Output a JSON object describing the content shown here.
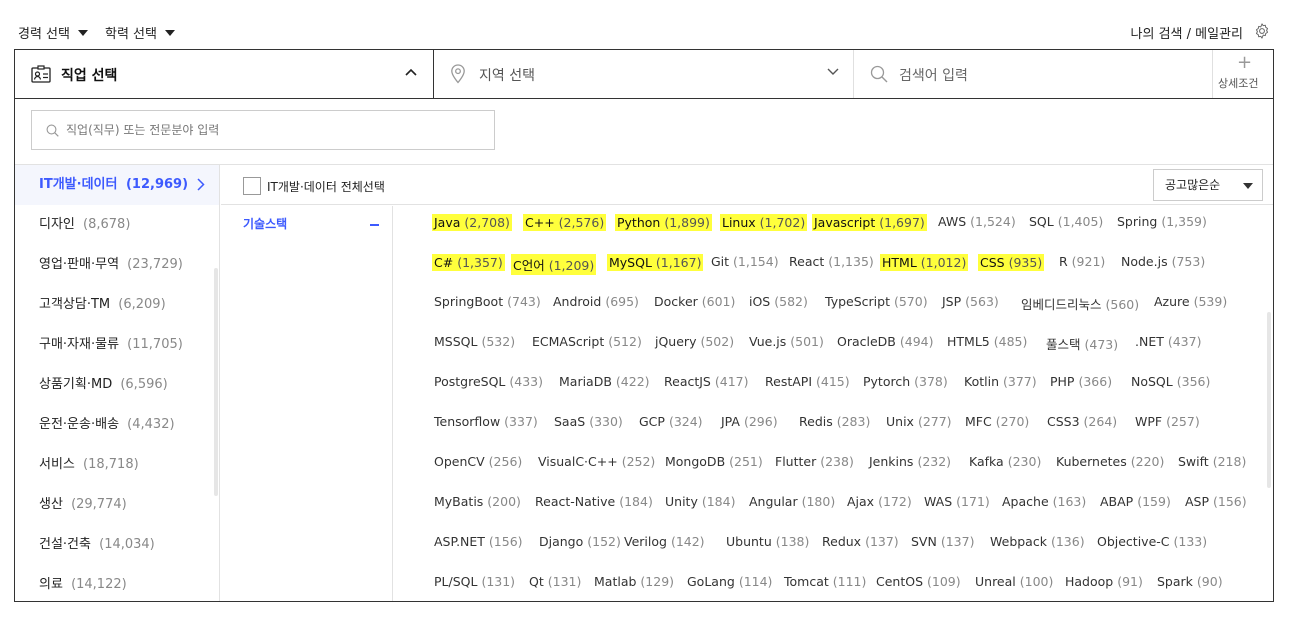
{
  "filters": {
    "career": "경력 선택",
    "education": "학력 선택",
    "my_search": "나의 검색 / 메일관리"
  },
  "searchbar": {
    "job": "직업 선택",
    "region": "지역 선택",
    "keyword_placeholder": "검색어 입력",
    "detail": "상세조건"
  },
  "job_search": {
    "placeholder": "직업(직무) 또는 전문분야 입력"
  },
  "categories": [
    {
      "name": "IT개발·데이터",
      "count": "(12,969)"
    },
    {
      "name": "디자인",
      "count": "(8,678)"
    },
    {
      "name": "영업·판매·무역",
      "count": "(23,729)"
    },
    {
      "name": "고객상담·TM",
      "count": "(6,209)"
    },
    {
      "name": "구매·자재·물류",
      "count": "(11,705)"
    },
    {
      "name": "상품기획·MD",
      "count": "(6,596)"
    },
    {
      "name": "운전·운송·배송",
      "count": "(4,432)"
    },
    {
      "name": "서비스",
      "count": "(18,718)"
    },
    {
      "name": "생산",
      "count": "(29,774)"
    },
    {
      "name": "건설·건축",
      "count": "(14,034)"
    },
    {
      "name": "의료",
      "count": "(14,122)"
    }
  ],
  "select_all_label": "IT개발·데이터 전체선택",
  "sort_label": "공고많은순",
  "subcategory": "기술스택",
  "skill_rows": [
    [
      {
        "name": "Java",
        "count": "(2,708)",
        "hl": true
      },
      {
        "name": "C++",
        "count": "(2,576)",
        "hl": true
      },
      {
        "name": "Python",
        "count": "(1,899)",
        "hl": true
      },
      {
        "name": "Linux",
        "count": "(1,702)",
        "hl": true
      },
      {
        "name": "Javascript",
        "count": "(1,697)",
        "hl": true
      },
      {
        "name": "AWS",
        "count": "(1,524)"
      },
      {
        "name": "SQL",
        "count": "(1,405)"
      },
      {
        "name": "Spring",
        "count": "(1,359)"
      }
    ],
    [
      {
        "name": "C#",
        "count": "(1,357)",
        "hl": true
      },
      {
        "name": "C언어",
        "count": "(1,209)",
        "hl": true
      },
      {
        "name": "MySQL",
        "count": "(1,167)",
        "hl": true
      },
      {
        "name": "Git",
        "count": "(1,154)"
      },
      {
        "name": "React",
        "count": "(1,135)"
      },
      {
        "name": "HTML",
        "count": "(1,012)",
        "hl": true
      },
      {
        "name": "CSS",
        "count": "(935)",
        "hl": true
      },
      {
        "name": "R",
        "count": "(921)"
      },
      {
        "name": "Node.js",
        "count": "(753)"
      }
    ],
    [
      {
        "name": "SpringBoot",
        "count": "(743)"
      },
      {
        "name": "Android",
        "count": "(695)"
      },
      {
        "name": "Docker",
        "count": "(601)"
      },
      {
        "name": "iOS",
        "count": "(582)"
      },
      {
        "name": "TypeScript",
        "count": "(570)"
      },
      {
        "name": "JSP",
        "count": "(563)"
      },
      {
        "name": "임베디드리눅스",
        "count": "(560)"
      },
      {
        "name": "Azure",
        "count": "(539)"
      }
    ],
    [
      {
        "name": "MSSQL",
        "count": "(532)"
      },
      {
        "name": "ECMAScript",
        "count": "(512)"
      },
      {
        "name": "jQuery",
        "count": "(502)"
      },
      {
        "name": "Vue.js",
        "count": "(501)"
      },
      {
        "name": "OracleDB",
        "count": "(494)"
      },
      {
        "name": "HTML5",
        "count": "(485)"
      },
      {
        "name": "풀스택",
        "count": "(473)"
      },
      {
        "name": ".NET",
        "count": "(437)"
      }
    ],
    [
      {
        "name": "PostgreSQL",
        "count": "(433)"
      },
      {
        "name": "MariaDB",
        "count": "(422)"
      },
      {
        "name": "ReactJS",
        "count": "(417)"
      },
      {
        "name": "RestAPI",
        "count": "(415)"
      },
      {
        "name": "Pytorch",
        "count": "(378)"
      },
      {
        "name": "Kotlin",
        "count": "(377)"
      },
      {
        "name": "PHP",
        "count": "(366)"
      },
      {
        "name": "NoSQL",
        "count": "(356)"
      }
    ],
    [
      {
        "name": "Tensorflow",
        "count": "(337)"
      },
      {
        "name": "SaaS",
        "count": "(330)"
      },
      {
        "name": "GCP",
        "count": "(324)"
      },
      {
        "name": "JPA",
        "count": "(296)"
      },
      {
        "name": "Redis",
        "count": "(283)"
      },
      {
        "name": "Unix",
        "count": "(277)"
      },
      {
        "name": "MFC",
        "count": "(270)"
      },
      {
        "name": "CSS3",
        "count": "(264)"
      },
      {
        "name": "WPF",
        "count": "(257)"
      }
    ],
    [
      {
        "name": "OpenCV",
        "count": "(256)"
      },
      {
        "name": "VisualC·C++",
        "count": "(252)"
      },
      {
        "name": "MongoDB",
        "count": "(251)"
      },
      {
        "name": "Flutter",
        "count": "(238)"
      },
      {
        "name": "Jenkins",
        "count": "(232)"
      },
      {
        "name": "Kafka",
        "count": "(230)"
      },
      {
        "name": "Kubernetes",
        "count": "(220)"
      },
      {
        "name": "Swift",
        "count": "(218)"
      }
    ],
    [
      {
        "name": "MyBatis",
        "count": "(200)"
      },
      {
        "name": "React-Native",
        "count": "(184)"
      },
      {
        "name": "Unity",
        "count": "(184)"
      },
      {
        "name": "Angular",
        "count": "(180)"
      },
      {
        "name": "Ajax",
        "count": "(172)"
      },
      {
        "name": "WAS",
        "count": "(171)"
      },
      {
        "name": "Apache",
        "count": "(163)"
      },
      {
        "name": "ABAP",
        "count": "(159)"
      },
      {
        "name": "ASP",
        "count": "(156)"
      }
    ],
    [
      {
        "name": "ASP.NET",
        "count": "(156)"
      },
      {
        "name": "Django",
        "count": "(152)"
      },
      {
        "name": "Verilog",
        "count": "(142)"
      },
      {
        "name": "Ubuntu",
        "count": "(138)"
      },
      {
        "name": "Redux",
        "count": "(137)"
      },
      {
        "name": "SVN",
        "count": "(137)"
      },
      {
        "name": "Webpack",
        "count": "(136)"
      },
      {
        "name": "Objective-C",
        "count": "(133)"
      }
    ],
    [
      {
        "name": "PL/SQL",
        "count": "(131)"
      },
      {
        "name": "Qt",
        "count": "(131)"
      },
      {
        "name": "Matlab",
        "count": "(129)"
      },
      {
        "name": "GoLang",
        "count": "(114)"
      },
      {
        "name": "Tomcat",
        "count": "(111)"
      },
      {
        "name": "CentOS",
        "count": "(109)"
      },
      {
        "name": "Unreal",
        "count": "(100)"
      },
      {
        "name": "Hadoop",
        "count": "(91)"
      },
      {
        "name": "Spark",
        "count": "(90)"
      }
    ]
  ],
  "colors": {
    "accent": "#3d5afe",
    "highlight": "#ffff3c"
  }
}
